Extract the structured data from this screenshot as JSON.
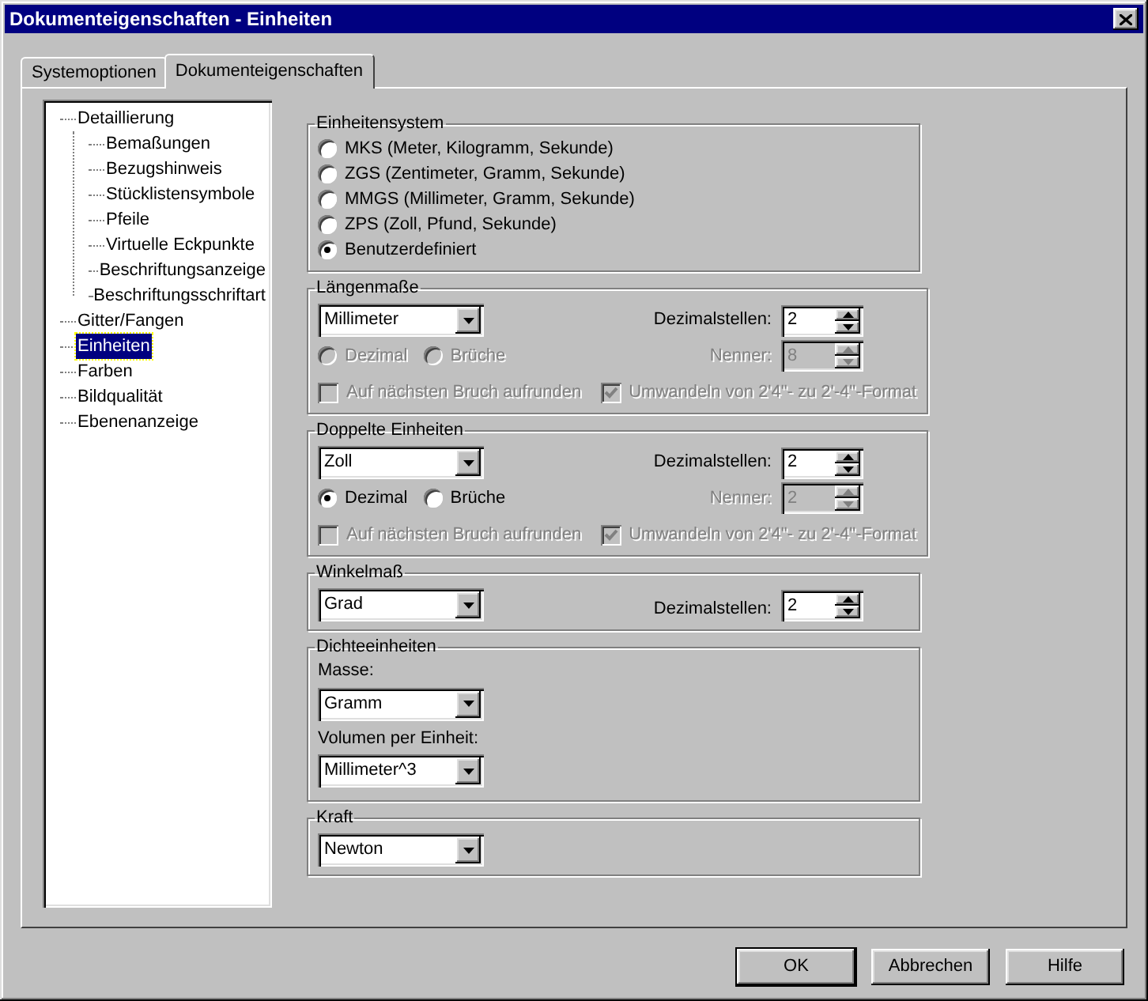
{
  "window": {
    "title": "Dokumenteigenschaften - Einheiten"
  },
  "tabs": [
    {
      "label": "Systemoptionen",
      "selected": false
    },
    {
      "label": "Dokumenteigenschaften",
      "selected": true
    }
  ],
  "tree": [
    {
      "label": "Detaillierung",
      "selected": false,
      "children": [
        {
          "label": "Bemaßungen",
          "selected": false
        },
        {
          "label": "Bezugshinweis",
          "selected": false
        },
        {
          "label": "Stücklistensymbole",
          "selected": false
        },
        {
          "label": "Pfeile",
          "selected": false
        },
        {
          "label": "Virtuelle Eckpunkte",
          "selected": false
        },
        {
          "label": "Beschriftungsanzeige",
          "selected": false
        },
        {
          "label": "Beschriftungsschriftart",
          "selected": false
        }
      ]
    },
    {
      "label": "Gitter/Fangen",
      "selected": false
    },
    {
      "label": "Einheiten",
      "selected": true
    },
    {
      "label": "Farben",
      "selected": false
    },
    {
      "label": "Bildqualität",
      "selected": false
    },
    {
      "label": "Ebenenanzeige",
      "selected": false
    }
  ],
  "groups": [
    {
      "kind": "radio_list",
      "title": "Einheitensystem",
      "options": [
        {
          "label": "MKS (Meter, Kilogramm, Sekunde)",
          "selected": false
        },
        {
          "label": "ZGS (Zentimeter, Gramm, Sekunde)",
          "selected": false
        },
        {
          "label": "MMGS (Millimeter, Gramm, Sekunde)",
          "selected": false
        },
        {
          "label": "ZPS (Zoll, Pfund, Sekunde)",
          "selected": false
        },
        {
          "label": "Benutzerdefiniert",
          "selected": true
        }
      ]
    },
    {
      "kind": "unit_format",
      "title": "Längenmaße",
      "unit": "Millimeter",
      "decimals_label": "Dezimalstellen:",
      "decimals": "2",
      "modes": [
        {
          "label": "Dezimal",
          "selected": false,
          "disabled": true
        },
        {
          "label": "Brüche",
          "selected": false,
          "disabled": true
        }
      ],
      "denominator_label": "Nenner:",
      "denominator": "8",
      "denominator_disabled": true,
      "options": [
        {
          "label": "Auf nächsten Bruch aufrunden",
          "checked": false,
          "disabled": true
        },
        {
          "label": "Umwandeln von 2'4\"- zu 2'-4\"-Format",
          "checked": true,
          "disabled": true
        }
      ]
    },
    {
      "kind": "unit_format",
      "title": "Doppelte Einheiten",
      "unit": "Zoll",
      "decimals_label": "Dezimalstellen:",
      "decimals": "2",
      "modes": [
        {
          "label": "Dezimal",
          "selected": true,
          "disabled": false
        },
        {
          "label": "Brüche",
          "selected": false,
          "disabled": false
        }
      ],
      "denominator_label": "Nenner:",
      "denominator": "2",
      "denominator_disabled": true,
      "options": [
        {
          "label": "Auf nächsten Bruch aufrunden",
          "checked": false,
          "disabled": true
        },
        {
          "label": "Umwandeln von 2'4\"- zu 2'-4\"-Format",
          "checked": true,
          "disabled": true
        }
      ]
    },
    {
      "kind": "unit_decimals",
      "title": "Winkelmaß",
      "unit": "Grad",
      "decimals_label": "Dezimalstellen:",
      "decimals": "2"
    },
    {
      "kind": "stacked_dropdowns",
      "title": "Dichteeinheiten",
      "fields": [
        {
          "label": "Masse:",
          "value": "Gramm"
        },
        {
          "label": "Volumen per Einheit:",
          "value": "Millimeter^3"
        }
      ]
    },
    {
      "kind": "dropdown",
      "title": "Kraft",
      "unit": "Newton"
    }
  ],
  "buttons": [
    {
      "label": "OK",
      "default": true
    },
    {
      "label": "Abbrechen",
      "default": false
    },
    {
      "label": "Hilfe",
      "default": false
    }
  ]
}
